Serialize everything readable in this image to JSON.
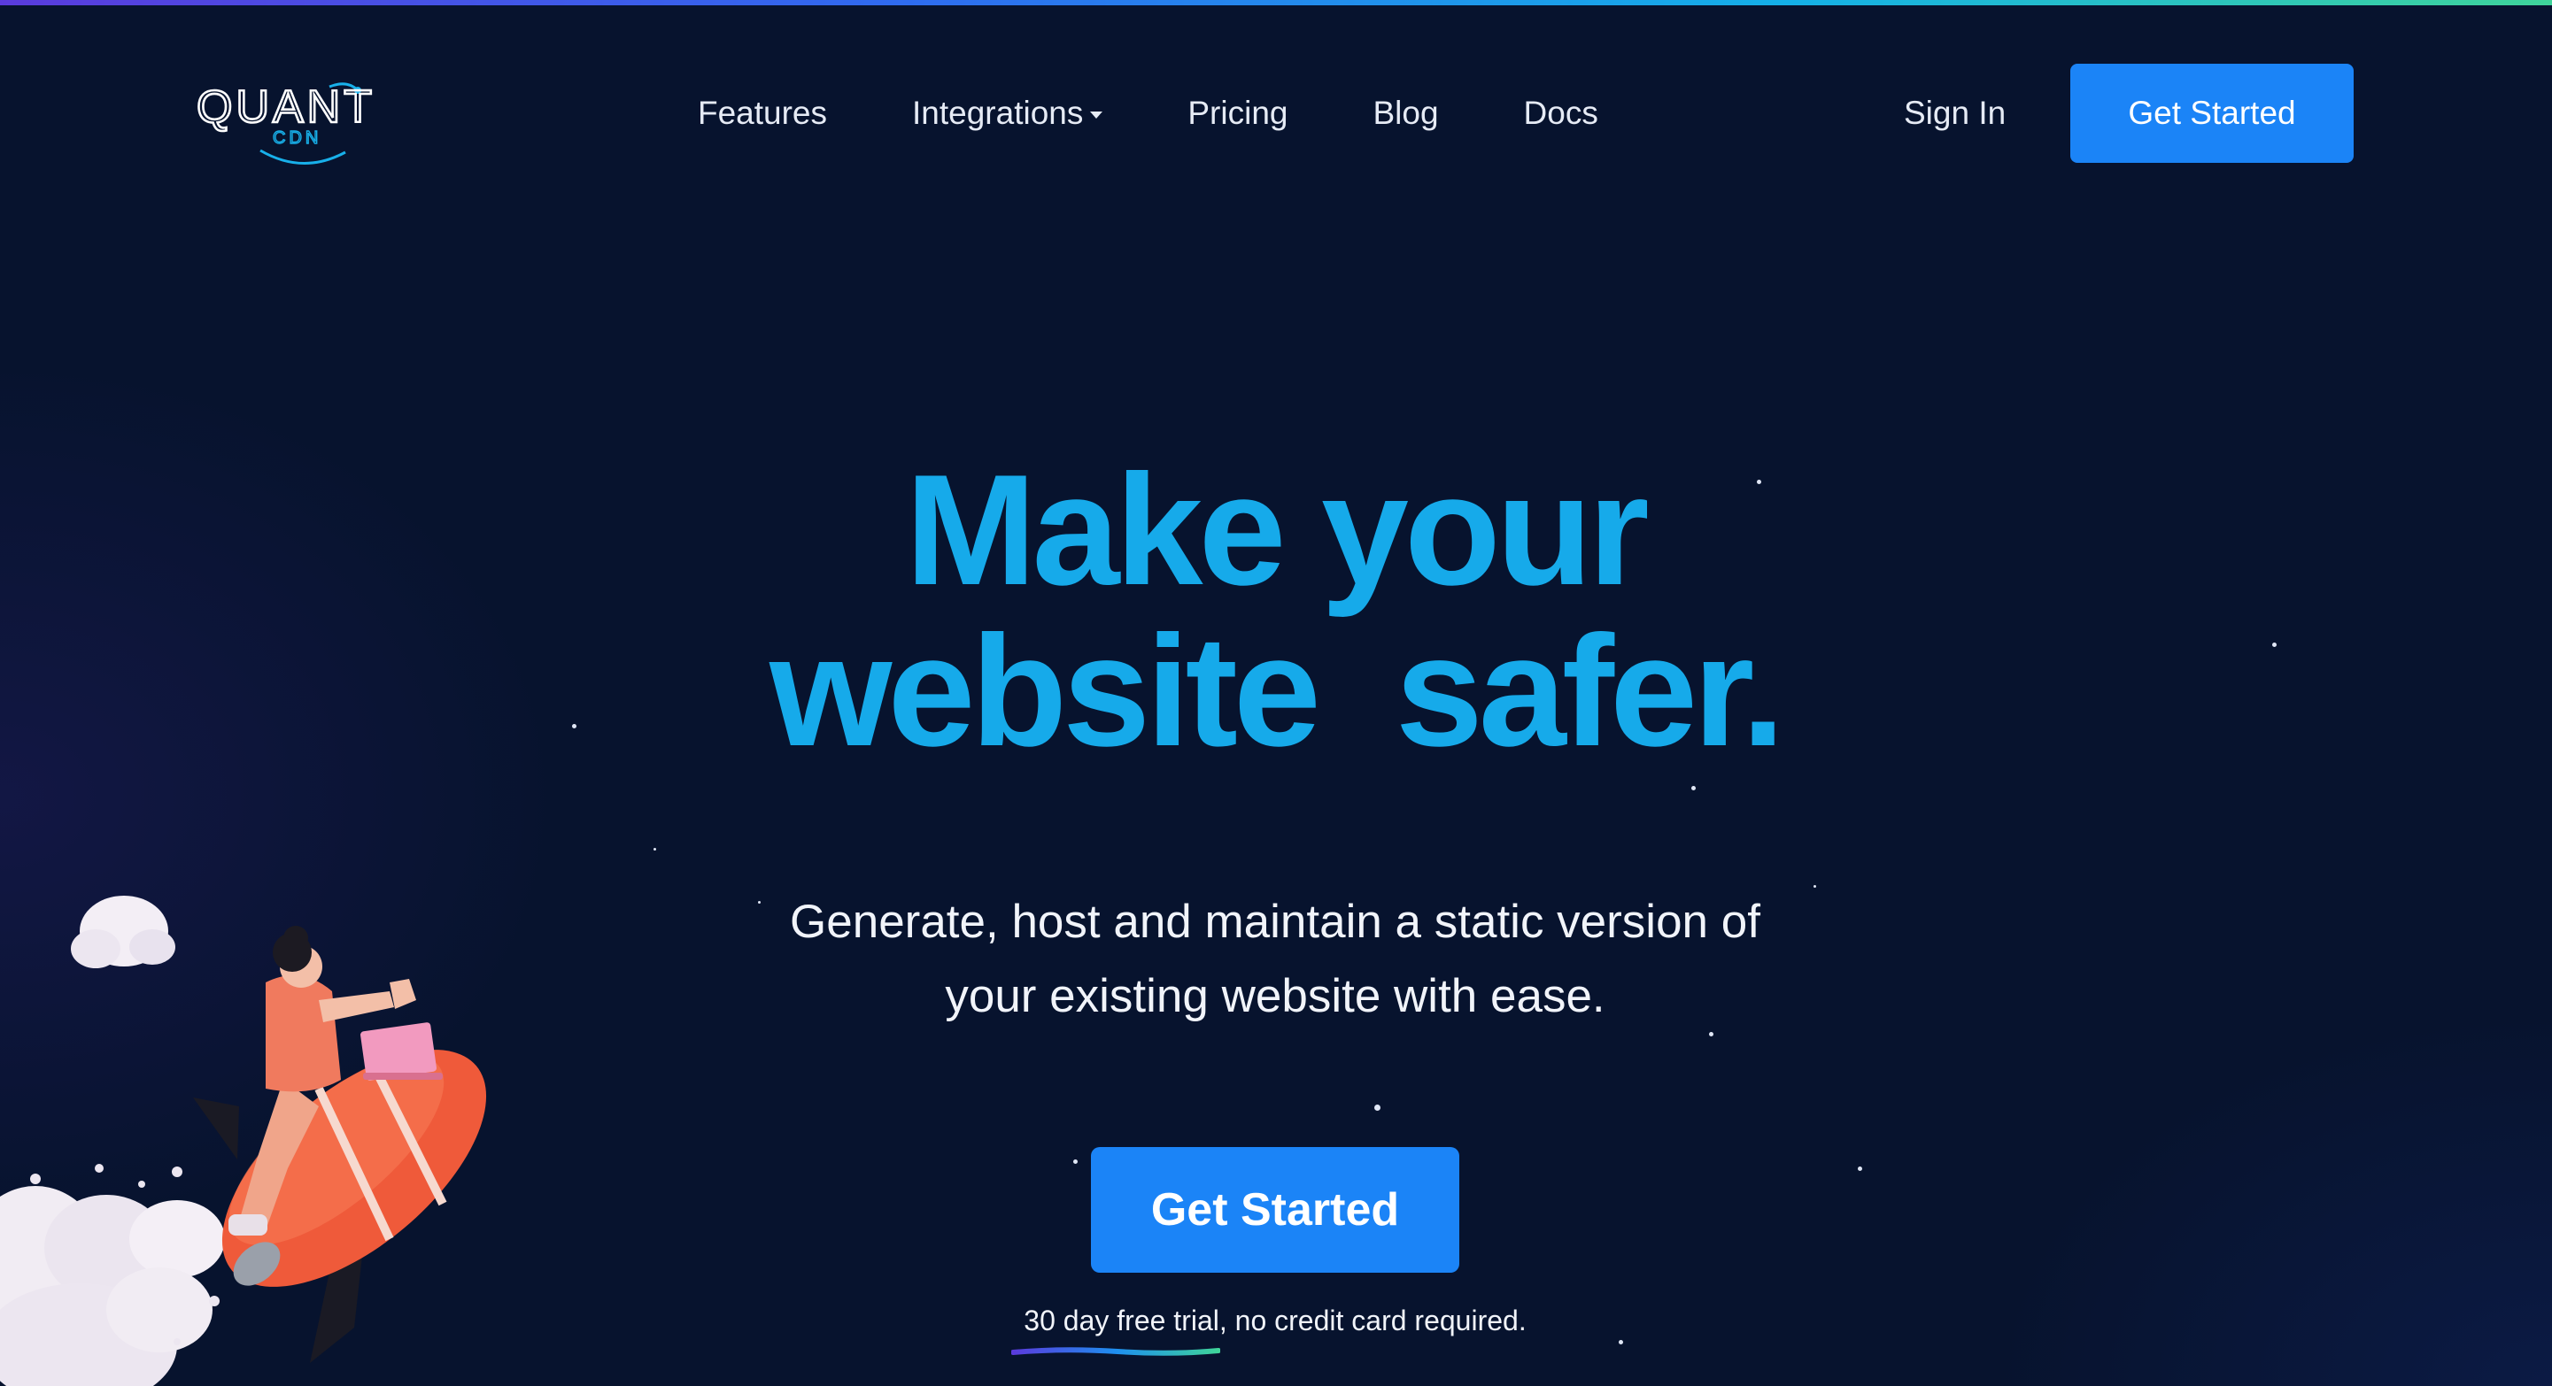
{
  "brand": {
    "logo_text": "QUANT",
    "logo_subtext": "CDN"
  },
  "nav": {
    "links": [
      "Features",
      "Integrations",
      "Pricing",
      "Blog",
      "Docs"
    ],
    "sign_in": "Sign In",
    "cta": "Get Started"
  },
  "hero": {
    "headline_line1": "Make your",
    "headline_line2": "website  safer.",
    "subtext_line1": "Generate, host and maintain a static version of",
    "subtext_line2": "your existing website with ease.",
    "cta": "Get Started",
    "note": "30 day free trial, no credit card required."
  },
  "colors": {
    "background": "#07132e",
    "accent": "#16aaea",
    "button": "#1b84f7",
    "text": "#f1f4fa"
  },
  "icons": {
    "integrations_dropdown": "caret-down-icon",
    "illustration": "rocket-rider-illustration"
  }
}
